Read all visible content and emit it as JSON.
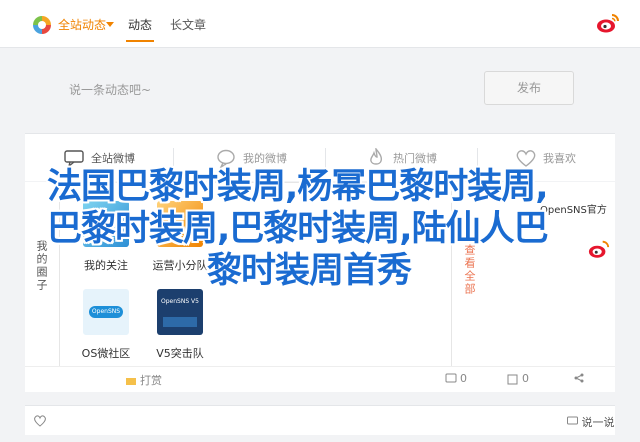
{
  "topbar": {
    "filter_label": "全站动态",
    "tabs": [
      "动态",
      "长文章"
    ],
    "active_tab": "动态"
  },
  "compose": {
    "placeholder": "说一条动态吧~",
    "publish_label": "发布"
  },
  "share": {
    "items": [
      "全站微博",
      "我的微博",
      "热门微博",
      "我喜欢"
    ]
  },
  "left_rail": {
    "label": "我的圈子"
  },
  "right_rail": {
    "label": "查看全部"
  },
  "popup": {
    "apps": [
      {
        "label": "我的关注",
        "tile": "avatar"
      },
      {
        "label": "运营小分队",
        "tile": "stock"
      },
      {
        "label": "OS微社区",
        "tile": "os",
        "tile_text": "OpenSNS"
      },
      {
        "label": "V5突击队",
        "tile": "v5",
        "tile_text": "OpenSNS V5"
      }
    ]
  },
  "right_panel": {
    "opensns_link": "OpenSNS官方"
  },
  "actions": {
    "like": "打赏",
    "comment_count": "0",
    "repost": "0"
  },
  "bottom": {
    "more": "说一说"
  },
  "headline": {
    "line1": "法国巴黎时装周,杨幂巴黎时装周,",
    "line2": "巴黎时装周,巴黎时装周,陆仙人巴",
    "line3": "黎时装周首秀"
  },
  "colors": {
    "accent": "#f08300",
    "headline": "#1a6bd1",
    "weibo_red": "#e6162d"
  }
}
